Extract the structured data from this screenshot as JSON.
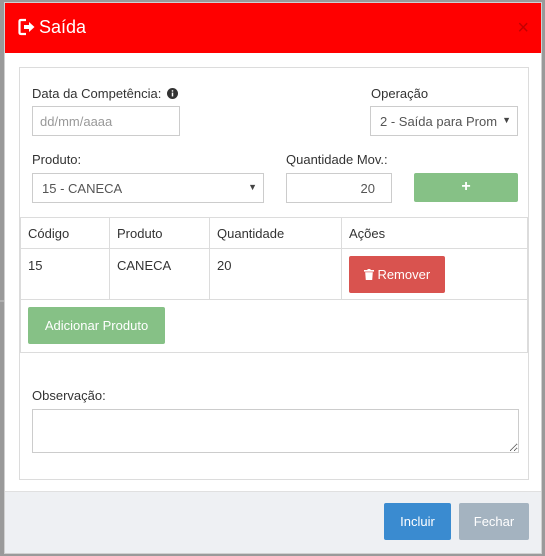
{
  "dialog": {
    "title": "Saída",
    "close_symbol": "×"
  },
  "form": {
    "data_label": "Data da Competência:",
    "data_placeholder": "dd/mm/aaaa",
    "operacao_label": "Operação",
    "operacao_value": "2 - Saída para Prom",
    "produto_label": "Produto:",
    "produto_value": "15 - CANECA",
    "quantidade_label": "Quantidade Mov.:",
    "quantidade_value": "20",
    "add_symbol": "+"
  },
  "table": {
    "headers": [
      "Código",
      "Produto",
      "Quantidade",
      "Ações"
    ],
    "rows": [
      {
        "codigo": "15",
        "produto": "CANECA",
        "quantidade": "20",
        "acao": "Remover"
      }
    ]
  },
  "adicionar_label": "Adicionar Produto",
  "observacao_label": "Observação:",
  "footer": {
    "incluir": "Incluir",
    "fechar": "Fechar"
  },
  "colors": {
    "header": "#ff0000",
    "green": "#86c186",
    "red": "#d9534f",
    "blue": "#3a8bd0",
    "gray": "#a4b3c0"
  }
}
